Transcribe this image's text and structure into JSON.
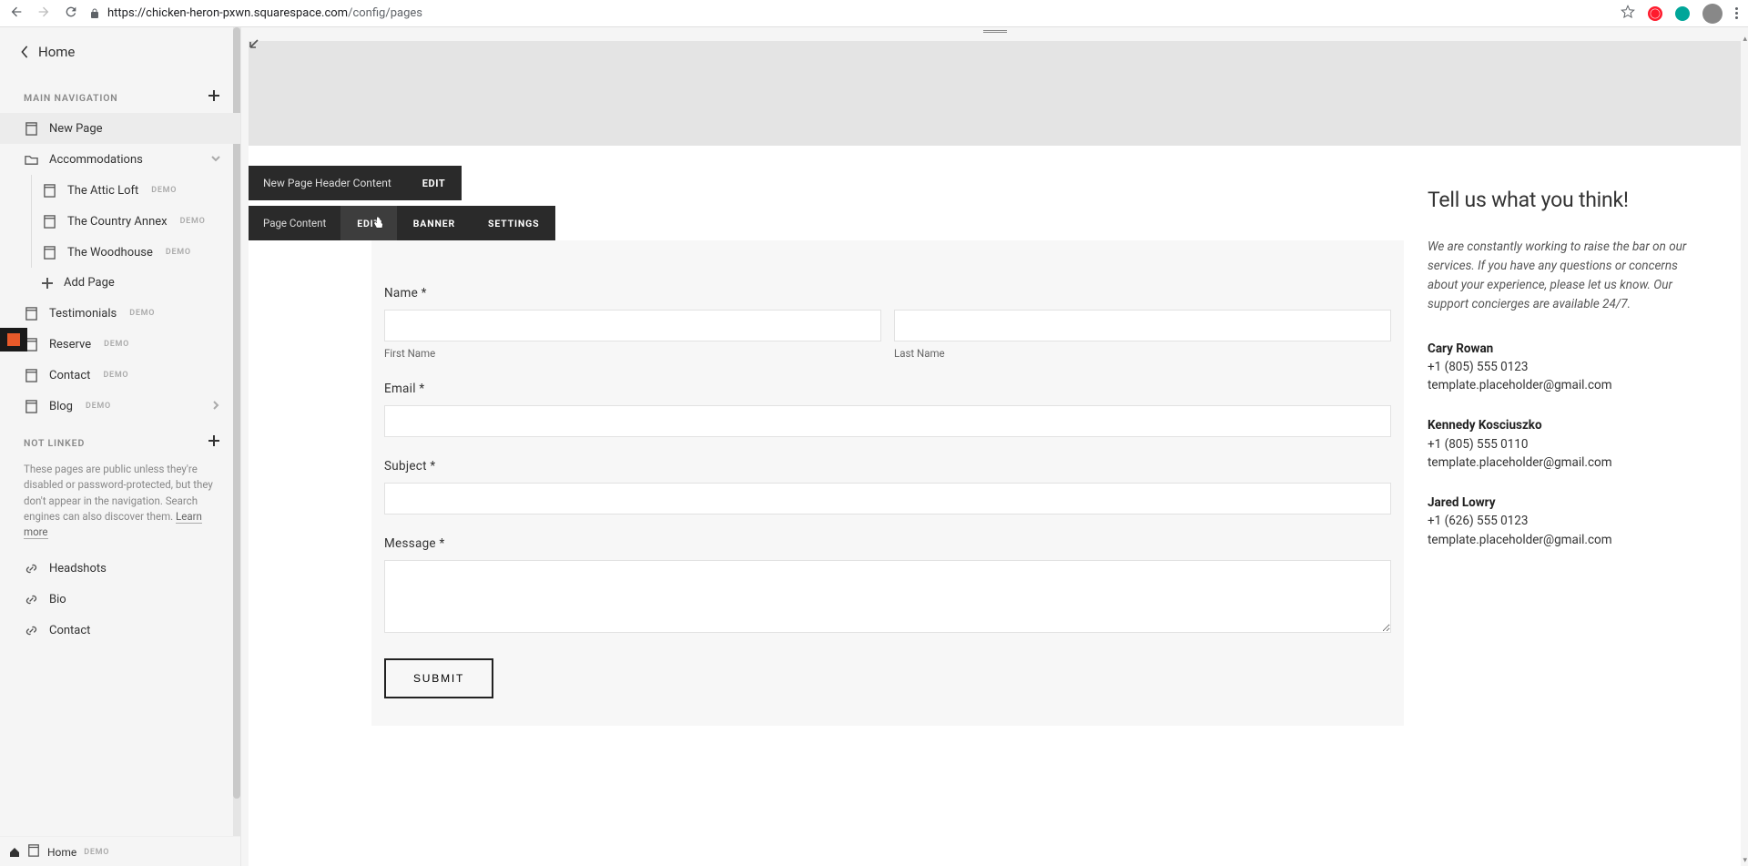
{
  "browser": {
    "url_host": "chicken-heron-pxwn.squarespace.com",
    "url_path": "/config/pages"
  },
  "sidebar": {
    "home": "Home",
    "section_main": "MAIN NAVIGATION",
    "section_notlinked": "NOT LINKED",
    "items": [
      {
        "label": "New Page",
        "type": "page",
        "selected": true
      },
      {
        "label": "Accommodations",
        "type": "folder",
        "expanded": true
      },
      {
        "label": "The Attic Loft",
        "type": "page",
        "demo": "DEMO",
        "child": true
      },
      {
        "label": "The Country Annex",
        "type": "page",
        "demo": "DEMO",
        "child": true
      },
      {
        "label": "The Woodhouse",
        "type": "page",
        "demo": "DEMO",
        "child": true
      },
      {
        "label": "Add Page",
        "type": "add"
      },
      {
        "label": "Testimonials",
        "type": "page",
        "demo": "DEMO"
      },
      {
        "label": "Reserve",
        "type": "page",
        "demo": "DEMO"
      },
      {
        "label": "Contact",
        "type": "page",
        "demo": "DEMO"
      },
      {
        "label": "Blog",
        "type": "page",
        "demo": "DEMO",
        "arrow": true
      }
    ],
    "notlinked_desc": "These pages are public unless they're disabled or password-protected, but they don't appear in the navigation. Search engines can also discover them. ",
    "learn_more": "Learn more",
    "notlinked_items": [
      {
        "label": "Headshots",
        "type": "link"
      },
      {
        "label": "Bio",
        "type": "link"
      },
      {
        "label": "Contact",
        "type": "link"
      }
    ],
    "bottom": {
      "label": "Home",
      "demo": "DEMO"
    }
  },
  "toolbars": {
    "header_label": "New Page Header Content",
    "header_edit": "EDIT",
    "content_label": "Page Content",
    "tabs": [
      "EDIT",
      "BANNER",
      "SETTINGS"
    ],
    "active_tab": 0
  },
  "form": {
    "name_label": "Name *",
    "first_name_sub": "First Name",
    "last_name_sub": "Last Name",
    "email_label": "Email *",
    "subject_label": "Subject *",
    "message_label": "Message *",
    "submit": "SUBMIT"
  },
  "side": {
    "title": "Tell us what you think!",
    "blurb": "We are constantly working to raise the bar on our services. If you have any questions or concerns about your experience, please let us know. Our support concierges are available 24/7.",
    "contacts": [
      {
        "name": "Cary Rowan",
        "phone": "+1 (805) 555 0123",
        "email": "template.placeholder@gmail.com"
      },
      {
        "name": "Kennedy Kosciuszko",
        "phone": "+1 (805) 555 0110",
        "email": "template.placeholder@gmail.com"
      },
      {
        "name": "Jared Lowry",
        "phone": "+1 (626) 555 0123",
        "email": "template.placeholder@gmail.com"
      }
    ]
  }
}
